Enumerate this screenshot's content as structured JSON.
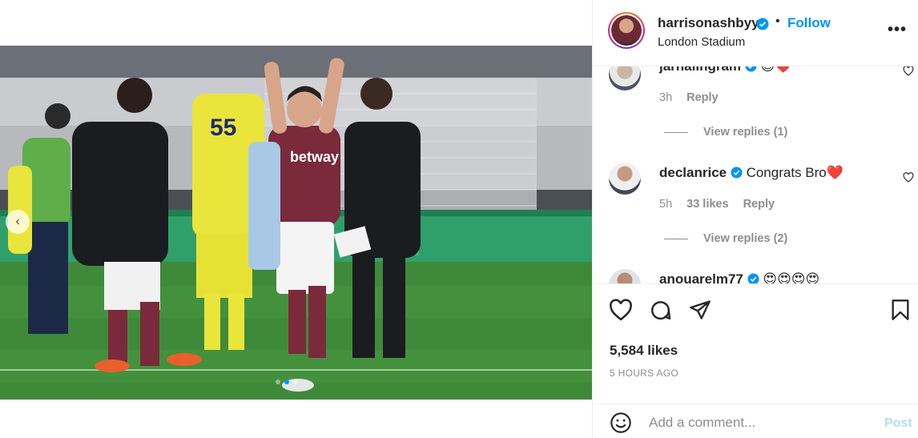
{
  "header": {
    "username": "harrisonashbyy",
    "separator": "•",
    "follow_label": "Follow",
    "location": "London Stadium",
    "more_label": "•••"
  },
  "comments": [
    {
      "username": "jarnalingram",
      "text": "",
      "emoji": "😍❤️",
      "time": "3h",
      "likes": "",
      "reply_label": "Reply",
      "view_replies": "View replies (1)"
    },
    {
      "username": "declanrice",
      "text": "Congrats Bro",
      "emoji": "❤️",
      "time": "5h",
      "likes": "33 likes",
      "reply_label": "Reply",
      "view_replies": "View replies (2)"
    },
    {
      "username": "anouarelm77",
      "text": "",
      "emoji": "😍😍😍😍",
      "time": "",
      "likes": "",
      "reply_label": "",
      "view_replies": ""
    }
  ],
  "actions": {
    "likes": "5,584 likes",
    "time_ago": "5 HOURS AGO"
  },
  "add_comment": {
    "placeholder": "Add a comment...",
    "post_label": "Post"
  },
  "media": {
    "carousel_prev": "‹",
    "active_dot": 1,
    "dot_count": 3,
    "jersey_number_left": "55",
    "sponsor": "betway"
  },
  "colors": {
    "accent": "#0095f6",
    "post_disabled": "#b3dbff",
    "heart_red": "#ed4956",
    "claret": "#7a2a3a",
    "pitch_green": "#3e8a3a"
  }
}
